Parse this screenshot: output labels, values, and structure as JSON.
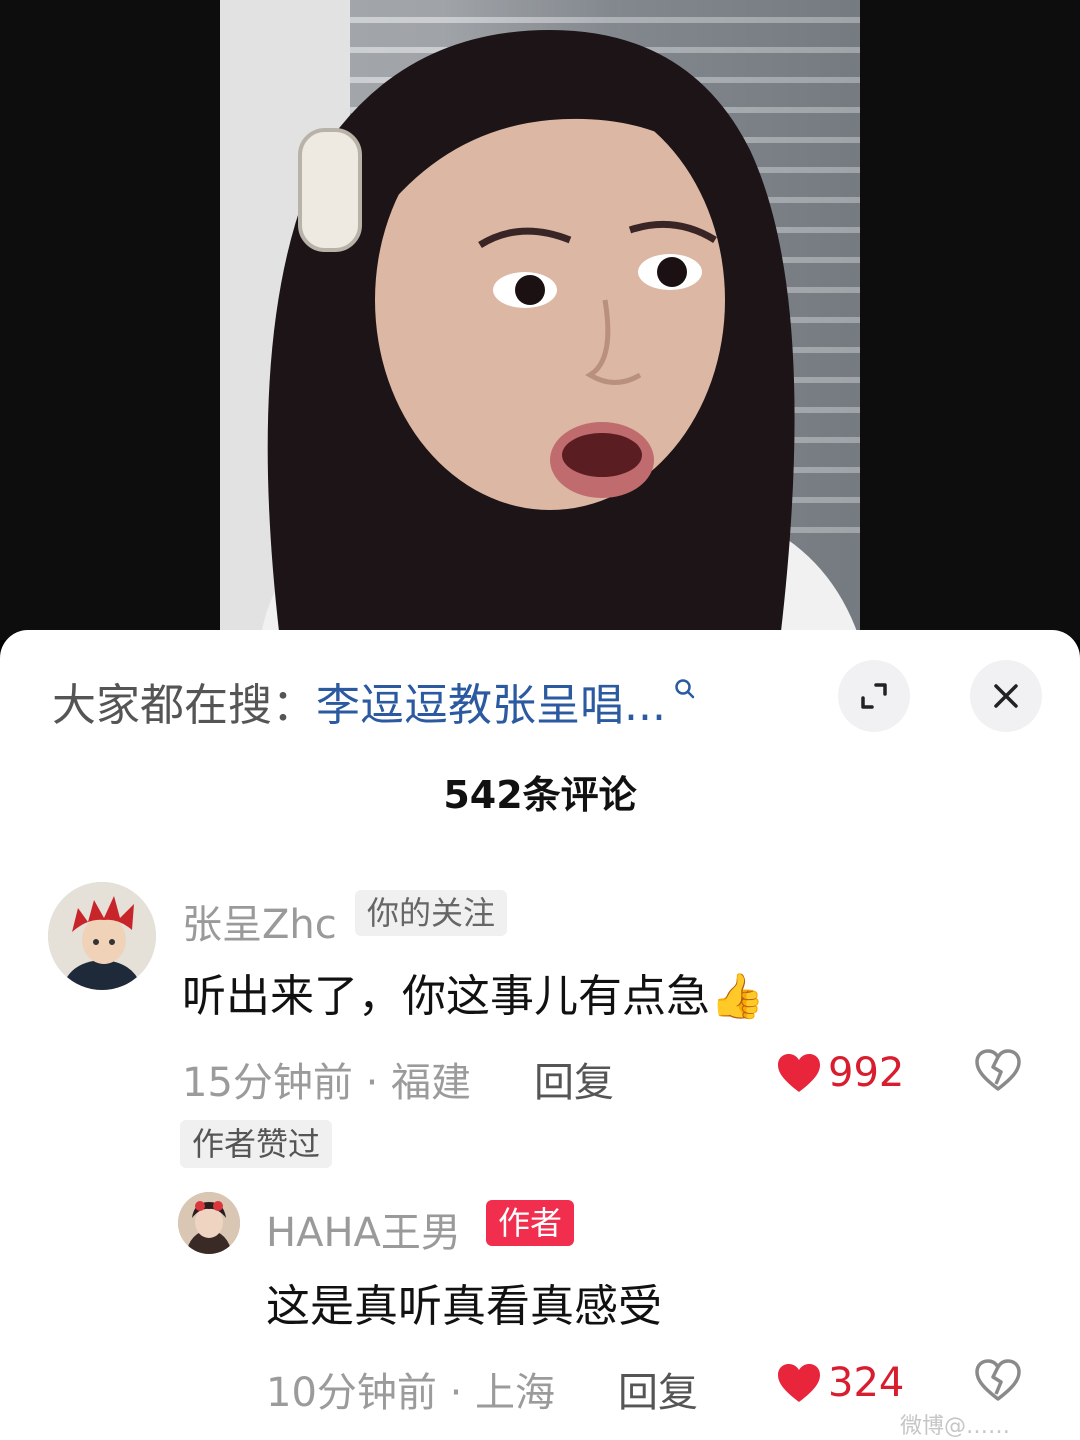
{
  "search": {
    "prefix": "大家都在搜：",
    "query": "李逗逗教张呈唱..."
  },
  "header": {
    "comment_count": "542条评论",
    "expand_icon": "expand-icon",
    "close_icon": "close-icon"
  },
  "comments": [
    {
      "username": "张呈Zhc",
      "tag": "你的关注",
      "text": "听出来了，你这事儿有点急👍",
      "time_location": "15分钟前 · 福建",
      "reply_label": "回复",
      "likes": "992",
      "author_liked_badge": "作者赞过"
    },
    {
      "username": "HAHA王男",
      "tag": "作者",
      "text": "这是真听真看真感受",
      "time_location": "10分钟前 · 上海",
      "reply_label": "回复",
      "likes": "324"
    }
  ],
  "watermark": "微博@……",
  "colors": {
    "like": "#e8253a",
    "author_tag": "#f22e4e",
    "search_query": "#2b5aa0"
  }
}
